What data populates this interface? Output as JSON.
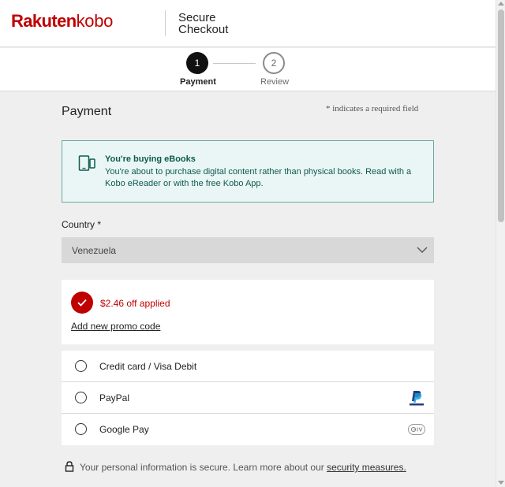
{
  "header": {
    "brand_rakuten": "Rakuten",
    "brand_kobo": "kobo",
    "title_line1": "Secure",
    "title_line2": "Checkout"
  },
  "stepper": {
    "steps": [
      {
        "number": "1",
        "label": "Payment",
        "active": true
      },
      {
        "number": "2",
        "label": "Review",
        "active": false
      }
    ]
  },
  "main": {
    "title": "Payment",
    "required_note": "* indicates a required field",
    "info_box": {
      "icon": "tablet-phone-icon",
      "title": "You're buying eBooks",
      "text": "You're about to purchase digital content rather than physical books. Read with a Kobo eReader or with the free Kobo App."
    },
    "country": {
      "label": "Country",
      "required_mark": "*",
      "value": "Venezuela"
    },
    "promo": {
      "applied_text": "$2.46 off applied",
      "add_link": "Add new promo code"
    },
    "payment_methods": [
      {
        "label": "Credit card / Visa Debit",
        "logo": ""
      },
      {
        "label": "PayPal",
        "logo": "paypal-logo"
      },
      {
        "label": "Google Pay",
        "logo": "gpay-logo"
      }
    ],
    "secure_note": {
      "text": "Your personal information is secure. Learn more about our ",
      "link": "security measures."
    }
  },
  "colors": {
    "brand_red": "#bf0000",
    "info_bg": "#eaf6f5",
    "info_border": "#6ea7a1",
    "info_text": "#0d5a50"
  }
}
